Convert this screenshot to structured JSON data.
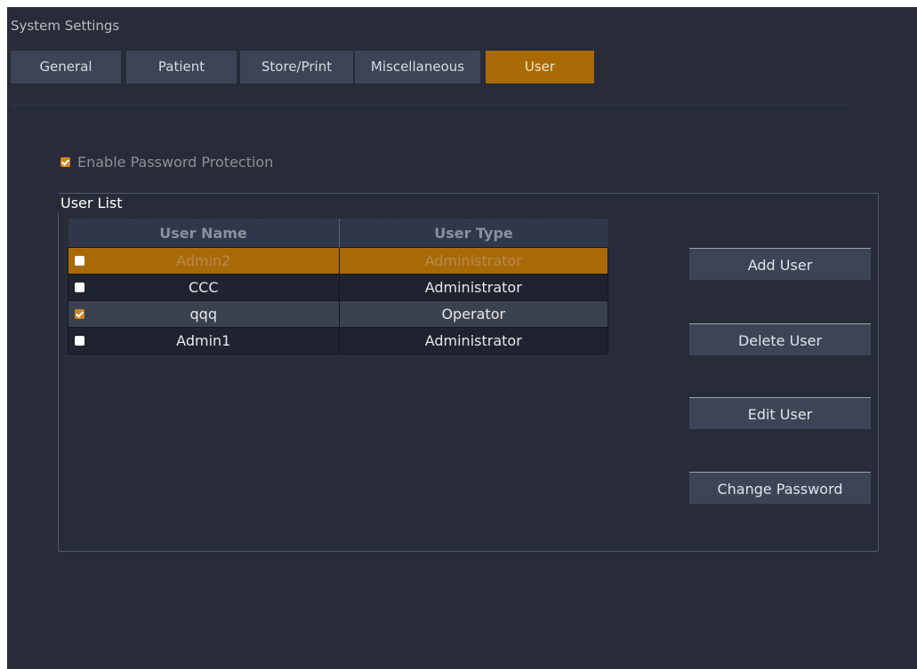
{
  "window": {
    "title": "System Settings"
  },
  "tabs": [
    {
      "label": "General",
      "active": false
    },
    {
      "label": "Patient",
      "active": false
    },
    {
      "label": "Store/Print",
      "active": false
    },
    {
      "label": "Miscellaneous",
      "active": false
    },
    {
      "label": "User",
      "active": true
    }
  ],
  "password_protection": {
    "label": "Enable Password Protection",
    "checked": true
  },
  "user_list": {
    "label": "User List",
    "columns": [
      "User Name",
      "User Type"
    ],
    "rows": [
      {
        "name": "Admin2",
        "type": "Administrator",
        "checked": false,
        "selected": true
      },
      {
        "name": "CCC",
        "type": "Administrator",
        "checked": false,
        "selected": false
      },
      {
        "name": "qqq",
        "type": "Operator",
        "checked": true,
        "selected": false
      },
      {
        "name": "Admin1",
        "type": "Administrator",
        "checked": false,
        "selected": false
      }
    ]
  },
  "actions": {
    "add_user": "Add User",
    "delete_user": "Delete User",
    "edit_user": "Edit User",
    "change_password": "Change Password"
  },
  "colors": {
    "background": "#272c38",
    "tab": "#3d4455",
    "accent": "#a86a07",
    "checkbox_checked": "#d08420"
  }
}
